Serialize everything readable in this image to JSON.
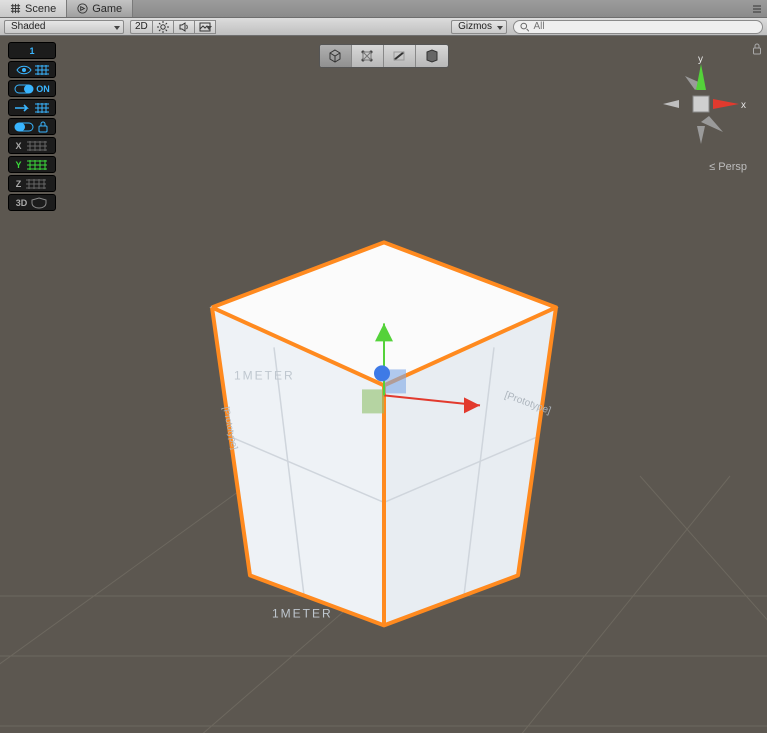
{
  "tabs": {
    "scene": "Scene",
    "game": "Game"
  },
  "toolbar": {
    "shading": "Shaded",
    "btn2d": "2D",
    "gizmos": "Gizmos",
    "search_placeholder": "All"
  },
  "progrid": {
    "snap": "1",
    "vis": "",
    "on": "ON",
    "push": "",
    "lock": "",
    "x": "X",
    "y": "Y",
    "z": "Z",
    "_3d": "3D"
  },
  "orient": {
    "x": "x",
    "y": "y",
    "mode": "Persp",
    "mode_prefix": "≤ "
  },
  "cube": {
    "label_top": "1METER",
    "label_bottom": "1METER",
    "label_proto_r": "[Prototype]",
    "label_proto_l": "[Prototype]"
  },
  "colors": {
    "selection": "#ff8a1f",
    "axis_x": "#e23a2e",
    "axis_y": "#54d23a",
    "axis_z": "#3e7ae6",
    "cyan": "#39b5ff"
  }
}
